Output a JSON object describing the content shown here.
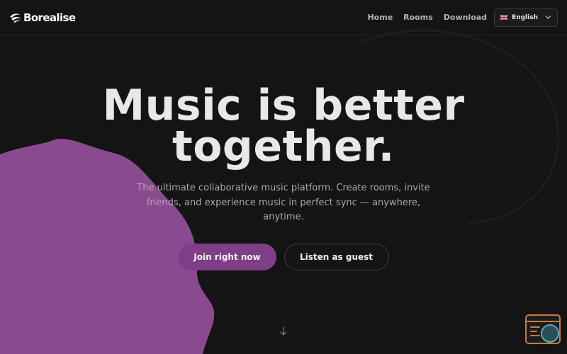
{
  "header": {
    "brand": "Borealise",
    "nav": [
      "Home",
      "Rooms",
      "Download"
    ],
    "language": "English"
  },
  "hero": {
    "title_line1": "Music is better",
    "title_line2": "together.",
    "subtitle": "The ultimate collaborative music platform. Create rooms, invite friends, and experience music in perfect sync — anywhere, anytime.",
    "primary_cta": "Join right now",
    "secondary_cta": "Listen as guest"
  },
  "icons": {
    "brand": "borealise-logo-icon",
    "flag": "uk-flag-icon",
    "language_toggle": "chevron-down-icon",
    "scroll": "arrow-down-icon",
    "widget": "search-widget-icon"
  },
  "colors": {
    "background": "#141414",
    "accent": "#7e3f86",
    "blob": "#8a4a90",
    "widget": "#c87a44"
  }
}
